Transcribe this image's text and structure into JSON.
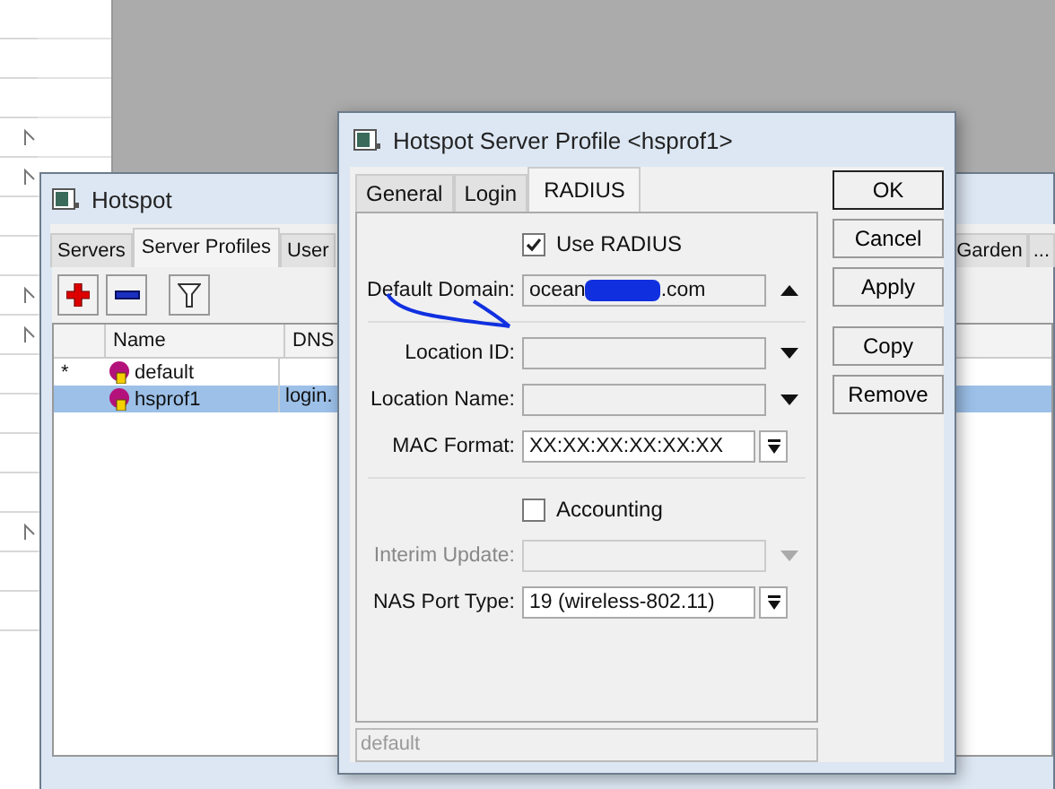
{
  "side_list": {
    "rows": [
      {
        "flag": false
      },
      {
        "flag": false
      },
      {
        "flag": false
      },
      {
        "flag": true
      },
      {
        "flag": true
      },
      {
        "flag": false
      },
      {
        "flag": false
      },
      {
        "flag": true
      },
      {
        "flag": true
      },
      {
        "flag": false
      },
      {
        "flag": false
      },
      {
        "flag": false
      },
      {
        "flag": false
      },
      {
        "flag": true
      },
      {
        "flag": false
      },
      {
        "flag": false
      }
    ]
  },
  "hotspot": {
    "title": "Hotspot",
    "tabs": [
      {
        "label": "Servers",
        "selected": false
      },
      {
        "label": "Server Profiles",
        "selected": true
      },
      {
        "label": "User",
        "selected": false
      }
    ],
    "right_tabs": [
      {
        "label": "Garden",
        "selected": false
      },
      {
        "label": "...",
        "selected": false
      }
    ],
    "columns": [
      "Name",
      "DNS"
    ],
    "rows": [
      {
        "flag": "*",
        "name": "default",
        "selected": false
      },
      {
        "name": "hsprof1",
        "dns": "login.",
        "selected": true
      }
    ]
  },
  "dialog": {
    "title": "Hotspot Server Profile <hsprof1>",
    "tabs": [
      {
        "label": "General",
        "selected": false
      },
      {
        "label": "Login",
        "selected": false
      },
      {
        "label": "RADIUS",
        "selected": true
      }
    ],
    "use_radius": {
      "label": "Use RADIUS",
      "checked": true
    },
    "default_domain": {
      "label": "Default Domain:",
      "value_start": "ocean",
      "value_end": ".com",
      "redacted": true
    },
    "fields": [
      {
        "label": "Location ID:",
        "kind": "combo",
        "disabled": false
      },
      {
        "label": "Location Name:",
        "kind": "combo",
        "disabled": false
      },
      {
        "label": "MAC Format:",
        "value": "XX:XX:XX:XX:XX:XX",
        "kind": "select",
        "disabled": false
      }
    ],
    "accounting": {
      "label": "Accounting",
      "checked": false
    },
    "fields2": [
      {
        "label": "Interim Update:",
        "kind": "combo",
        "disabled": true
      },
      {
        "label": "NAS Port Type:",
        "value": "19 (wireless-802.11)",
        "kind": "select",
        "disabled": false
      }
    ],
    "status": "default",
    "buttons": [
      "OK",
      "Cancel",
      "Apply",
      "Copy",
      "Remove"
    ]
  }
}
